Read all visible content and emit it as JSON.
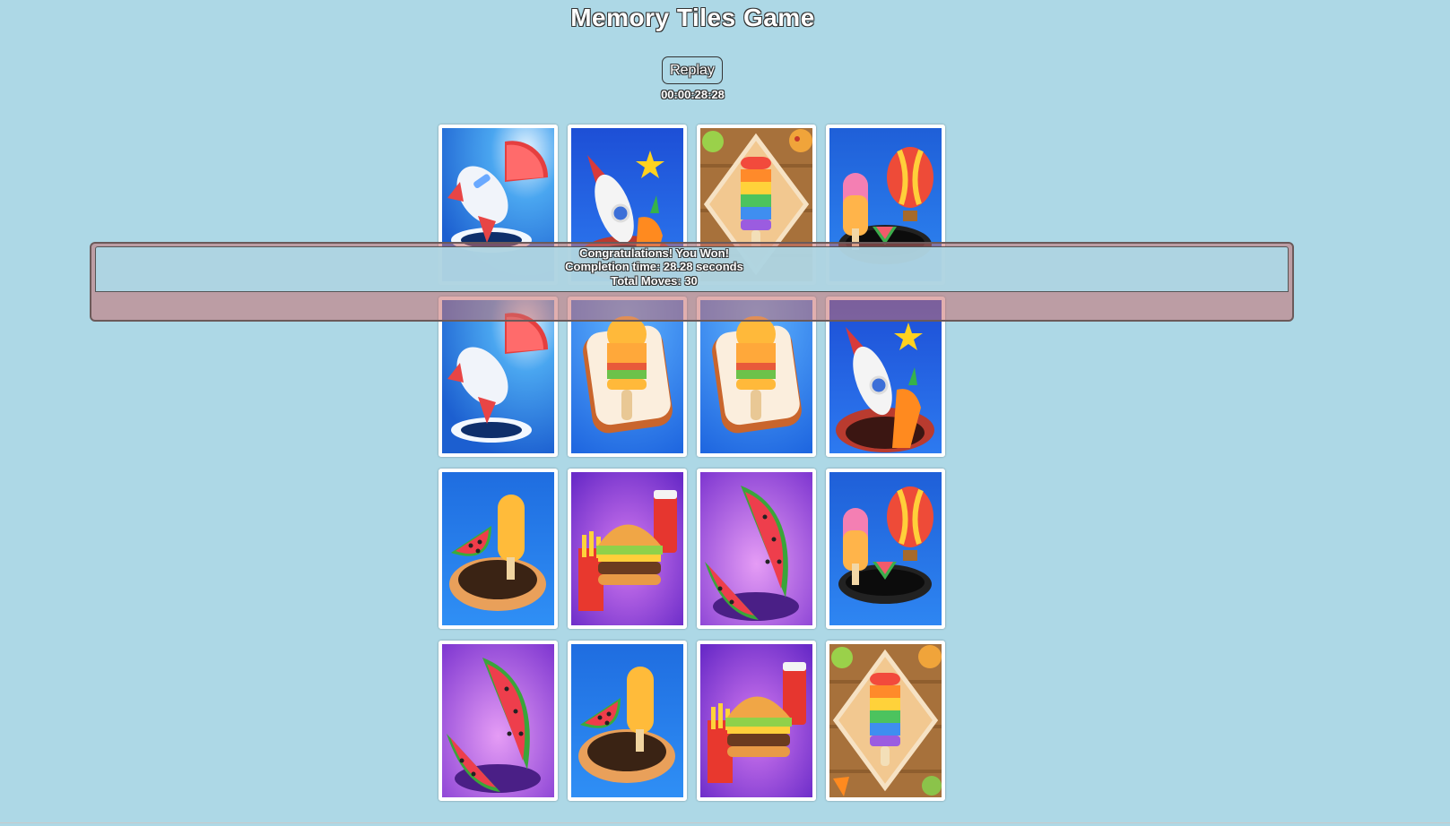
{
  "header": {
    "title": "Memory Tiles Game",
    "replay_label": "Replay",
    "timer": "00:00:28:28"
  },
  "board": {
    "tiles": [
      {
        "image": "airplane-watermelon-icon"
      },
      {
        "image": "rocket-carrot-icon"
      },
      {
        "image": "rainbow-popsicle-icon"
      },
      {
        "image": "balloon-popsicle-icon"
      },
      {
        "image": "airplane-watermelon-icon"
      },
      {
        "image": "orange-popsicle-icon"
      },
      {
        "image": "orange-popsicle-icon"
      },
      {
        "image": "rocket-carrot-icon"
      },
      {
        "image": "watermelon-popsicle-hole-icon"
      },
      {
        "image": "burger-fries-icon"
      },
      {
        "image": "watermelon-slices-icon"
      },
      {
        "image": "balloon-popsicle-icon"
      },
      {
        "image": "watermelon-slices-icon"
      },
      {
        "image": "watermelon-popsicle-hole-icon"
      },
      {
        "image": "burger-fries-icon"
      },
      {
        "image": "rainbow-popsicle-icon"
      }
    ]
  },
  "result": {
    "message": "Congratulations! You Won!",
    "completion_time": "Completion time: 28.28 seconds",
    "total_moves": "Total Moves: 30"
  },
  "colors": {
    "background": "#add8e6",
    "tile_border": "#ffffff",
    "overlay": "#c86e6e"
  }
}
